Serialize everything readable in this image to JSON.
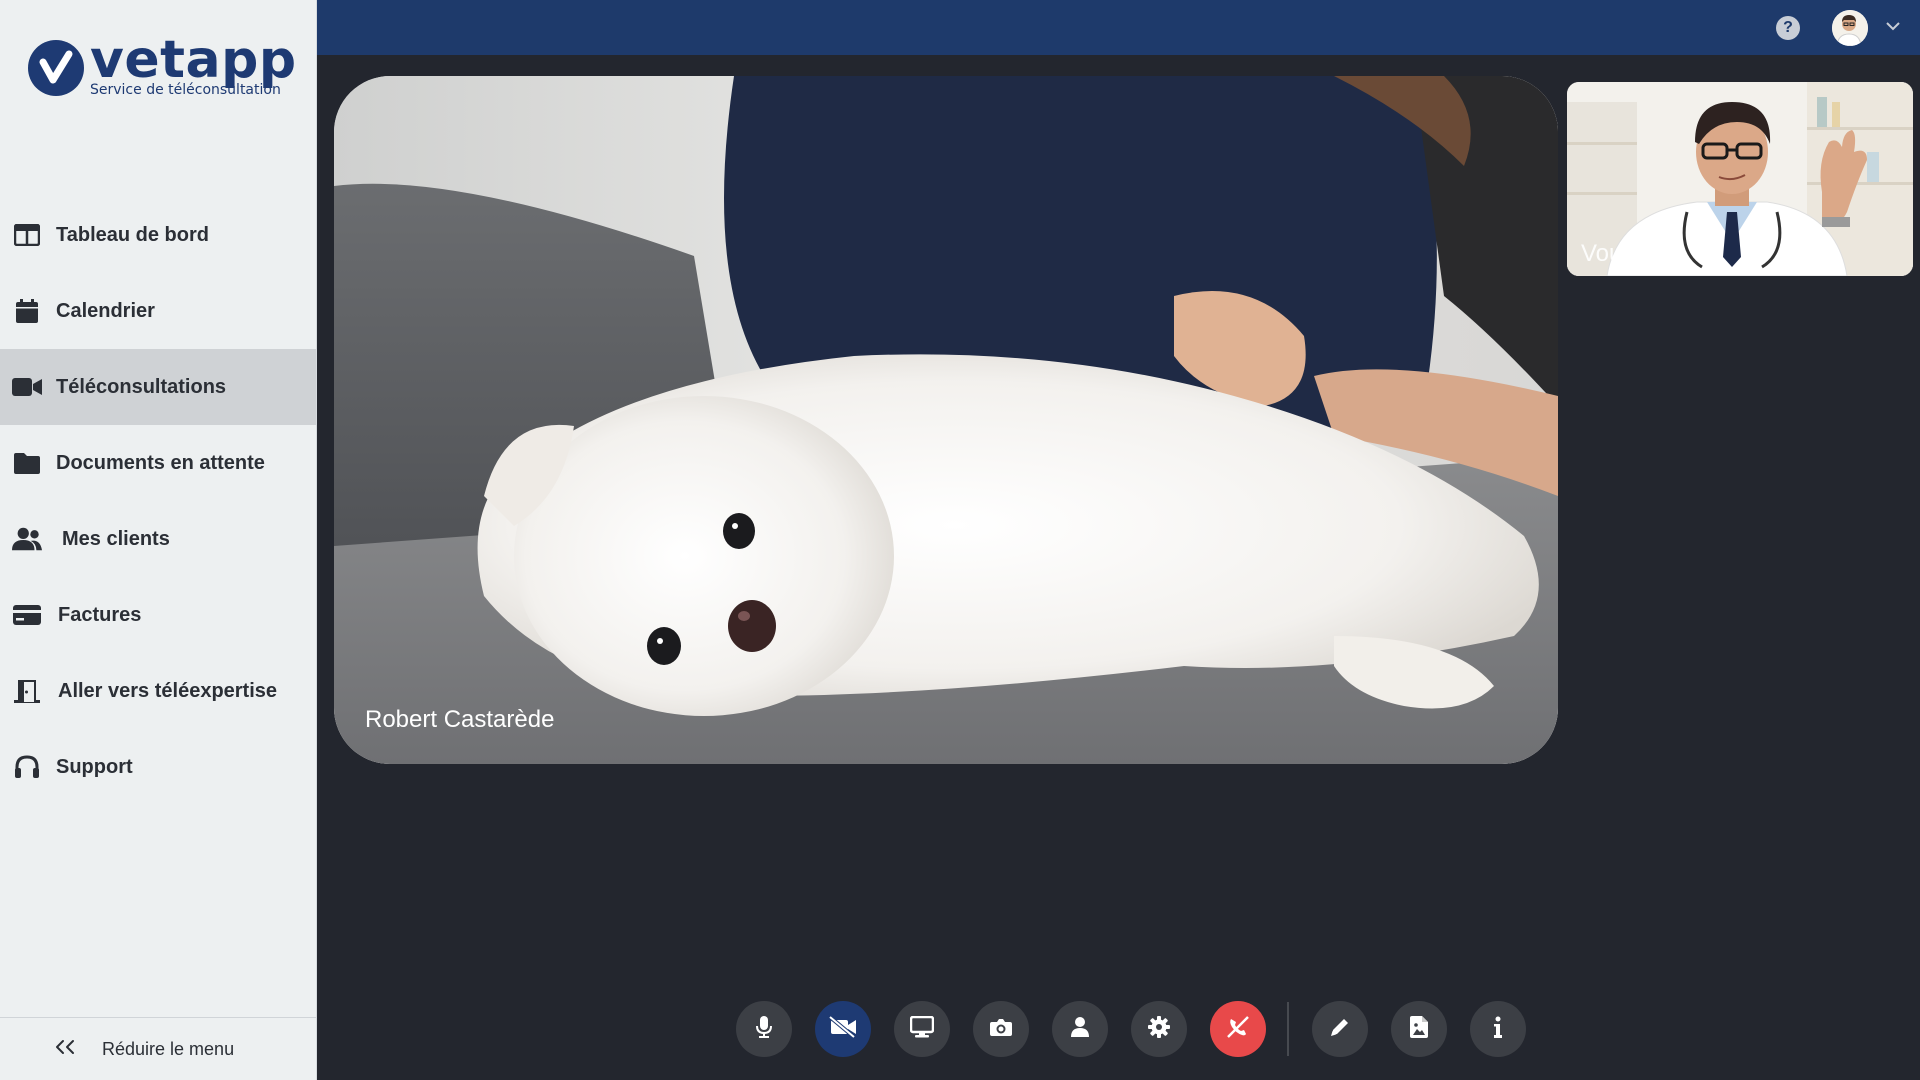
{
  "brand": {
    "name": "vetapp",
    "tagline": "Service de téléconsultation",
    "color": "#1e3a73"
  },
  "sidebar": {
    "items": [
      {
        "label": "Tableau de bord",
        "icon": "dashboard-icon",
        "active": false
      },
      {
        "label": "Calendrier",
        "icon": "calendar-icon",
        "active": false
      },
      {
        "label": "Téléconsultations",
        "icon": "video-camera-icon",
        "active": true
      },
      {
        "label": "Documents en attente",
        "icon": "folder-icon",
        "active": false
      },
      {
        "label": "Mes clients",
        "icon": "users-icon",
        "active": false
      },
      {
        "label": "Factures",
        "icon": "credit-card-icon",
        "active": false
      },
      {
        "label": "Aller vers téléexpertise",
        "icon": "door-exit-icon",
        "active": false
      },
      {
        "label": "Support",
        "icon": "headset-icon",
        "active": false
      }
    ],
    "collapse_label": "Réduire le menu"
  },
  "topbar": {
    "help_symbol": "?",
    "background": "#1e3a6b"
  },
  "call": {
    "remote_name": "Robert Castarède",
    "self_label": "Vous"
  },
  "controls": [
    {
      "name": "microphone",
      "icon": "microphone-icon"
    },
    {
      "name": "camera-off",
      "icon": "video-off-icon",
      "accent": "#1e3a73"
    },
    {
      "name": "screen-share",
      "icon": "monitor-icon"
    },
    {
      "name": "snapshot",
      "icon": "photo-camera-icon"
    },
    {
      "name": "participant",
      "icon": "person-icon"
    },
    {
      "name": "settings",
      "icon": "gear-icon"
    },
    {
      "name": "hang-up",
      "icon": "phone-hangup-icon",
      "accent": "#e8494a"
    },
    {
      "name": "notes",
      "icon": "pencil-icon"
    },
    {
      "name": "document",
      "icon": "file-image-icon"
    },
    {
      "name": "info",
      "icon": "info-icon"
    }
  ]
}
